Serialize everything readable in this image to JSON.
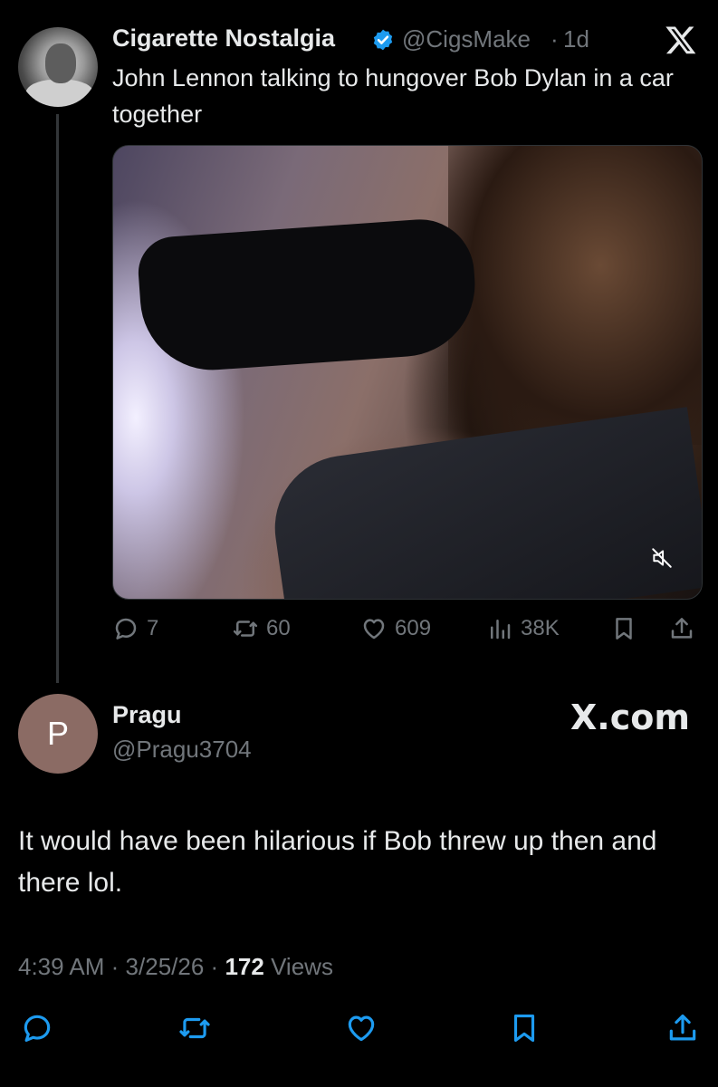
{
  "quoted_tweet": {
    "author_name": "Cigarette Nostalgia",
    "handle": "@CigsMake",
    "separator": "·",
    "time": "1d",
    "text": "John Lennon talking to hungover Bob Dylan in a car together",
    "actions": {
      "replies": "7",
      "retweets": "60",
      "likes": "609",
      "views": "38K"
    },
    "icons": {
      "verified": "verified-badge-icon",
      "logo": "x-logo-icon",
      "mute": "muted-speaker-icon"
    },
    "accent_color": "#1d9bf0"
  },
  "reply": {
    "avatar_letter": "P",
    "author_name": "Pragu",
    "handle": "@Pragu3704",
    "brand": "X.com",
    "text": "It would have been hilarious if Bob threw up then and there lol.",
    "time": "4:39 AM",
    "date": "3/25/26",
    "dot": "·",
    "views_count": "172",
    "views_label": "Views",
    "avatar_color": "#8b6b64"
  },
  "bottom_bar": [
    "reply-icon",
    "retweet-icon",
    "like-icon",
    "bookmark-icon",
    "share-icon"
  ]
}
